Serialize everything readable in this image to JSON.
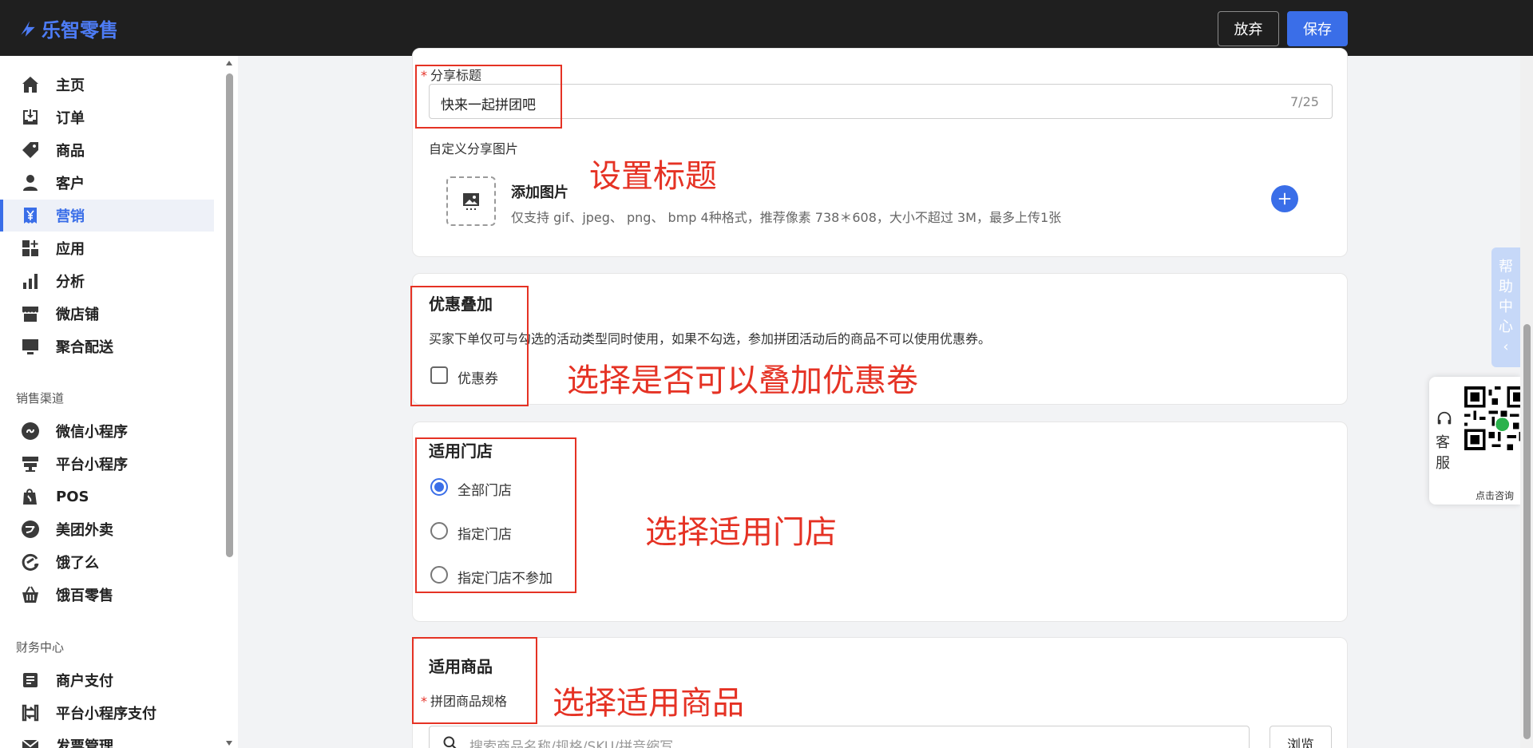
{
  "app": {
    "logo_text": "乐智零售"
  },
  "topbar": {
    "discard_label": "放弃",
    "save_label": "保存"
  },
  "sidebar": {
    "items": [
      {
        "label": "主页",
        "icon": "home-icon"
      },
      {
        "label": "订单",
        "icon": "order-icon"
      },
      {
        "label": "商品",
        "icon": "tag-icon"
      },
      {
        "label": "客户",
        "icon": "person-icon"
      },
      {
        "label": "营销",
        "icon": "yen-icon",
        "active": true
      },
      {
        "label": "应用",
        "icon": "apps-icon"
      },
      {
        "label": "分析",
        "icon": "chart-icon"
      },
      {
        "label": "微店铺",
        "icon": "store-icon"
      },
      {
        "label": "聚合配送",
        "icon": "monitor-icon"
      }
    ],
    "sales_channel_title": "销售渠道",
    "channels": [
      {
        "label": "微信小程序",
        "icon": "miniprogram-icon"
      },
      {
        "label": "平台小程序",
        "icon": "platform-store-icon"
      },
      {
        "label": "POS",
        "icon": "pos-bag-icon"
      },
      {
        "label": "美团外卖",
        "icon": "meituan-icon"
      },
      {
        "label": "饿了么",
        "icon": "eleme-icon"
      },
      {
        "label": "饿百零售",
        "icon": "basket-icon"
      }
    ],
    "finance_title": "财务中心",
    "finance": [
      {
        "label": "商户支付",
        "icon": "list-doc-icon"
      },
      {
        "label": "平台小程序支付",
        "icon": "transfer-icon"
      },
      {
        "label": "发票管理",
        "icon": "mail-icon"
      }
    ]
  },
  "share": {
    "title_label": "分享标题",
    "title_value": "快来一起拼团吧",
    "title_counter": "7/25",
    "custom_image_label": "自定义分享图片",
    "add_image_title": "添加图片",
    "add_image_hint": "仅支持 gif、jpeg、 png、 bmp 4种格式，推荐像素 738＊608，大小不超过 3M，最多上传1张"
  },
  "coupon": {
    "title": "优惠叠加",
    "desc": "买家下单仅可与勾选的活动类型同时使用，如果不勾选，参加拼团活动后的商品不可以使用优惠券。",
    "option_label": "优惠券",
    "checked": false
  },
  "stores": {
    "title": "适用门店",
    "options": [
      "全部门店",
      "指定门店",
      "指定门店不参加"
    ],
    "selected": 0
  },
  "products": {
    "title": "适用商品",
    "spec_label": "拼团商品规格",
    "search_placeholder": "搜索商品名称/规格/SKU/拼音缩写",
    "browse_label": "浏览"
  },
  "annotations": {
    "set_title": "设置标题",
    "stack_coupon": "选择是否可以叠加优惠卷",
    "choose_store": "选择适用门店",
    "choose_product": "选择适用商品"
  },
  "help": {
    "tab_text": [
      "帮",
      "助",
      "中",
      "心",
      "‹"
    ],
    "service_text": [
      "客",
      "服"
    ],
    "consult_text": "点击咨询"
  },
  "colors": {
    "accent": "#3a6ee8",
    "annotation": "#e53224",
    "topbar": "#1f1f1f"
  }
}
